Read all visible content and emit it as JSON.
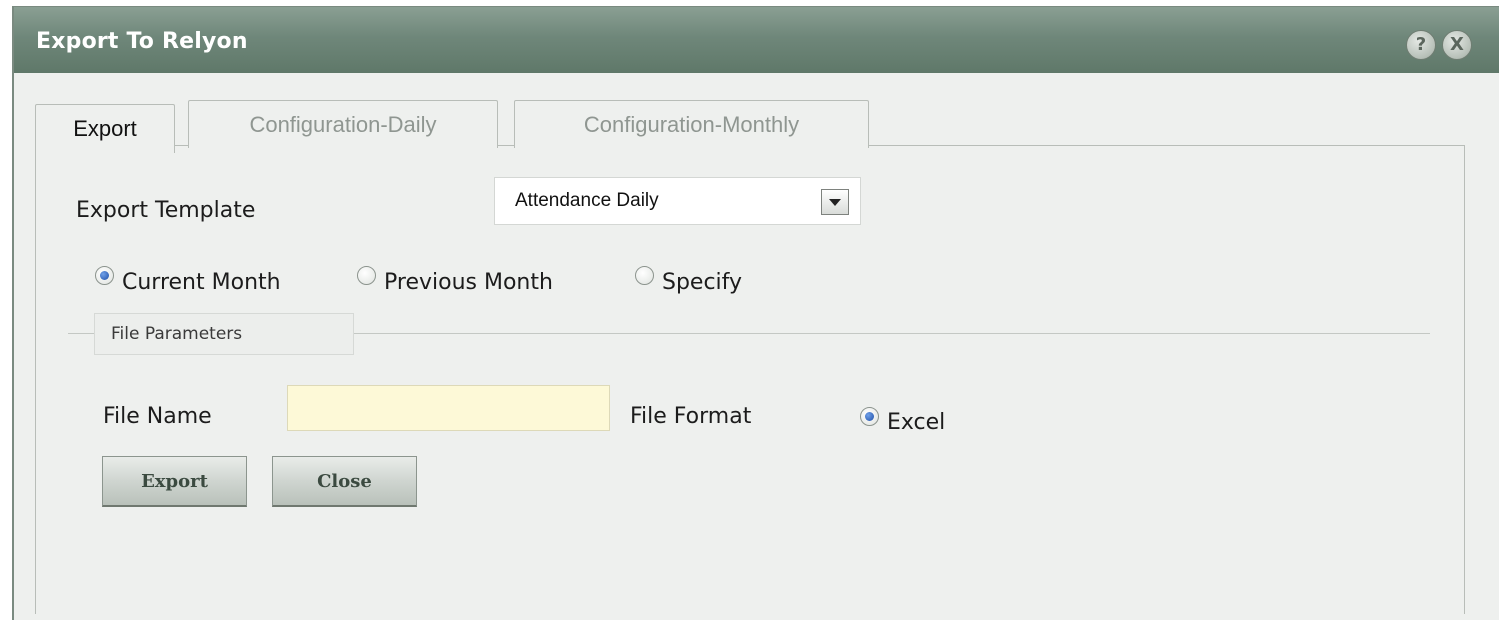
{
  "window": {
    "title": "Export To Relyon",
    "help_label": "?",
    "close_label": "X"
  },
  "tabs": [
    {
      "label": "Export",
      "active": true
    },
    {
      "label": "Configuration-Daily",
      "active": false
    },
    {
      "label": "Configuration-Monthly",
      "active": false
    }
  ],
  "form": {
    "template_label": "Export Template",
    "template_value": "Attendance Daily",
    "period_options": [
      {
        "label": "Current Month",
        "checked": true
      },
      {
        "label": "Previous Month",
        "checked": false
      },
      {
        "label": "Specify",
        "checked": false
      }
    ],
    "fieldset_legend": "File Parameters",
    "file_name_label": "File Name",
    "file_name_value": "",
    "file_format_label": "File Format",
    "file_format_option": {
      "label": "Excel",
      "checked": true
    }
  },
  "buttons": {
    "export_label": "Export",
    "close_label": "Close"
  },
  "colors": {
    "titlebar": "#6f877a",
    "input_background": "#fdf9d7",
    "radio_checked": "#1f4fa8"
  }
}
